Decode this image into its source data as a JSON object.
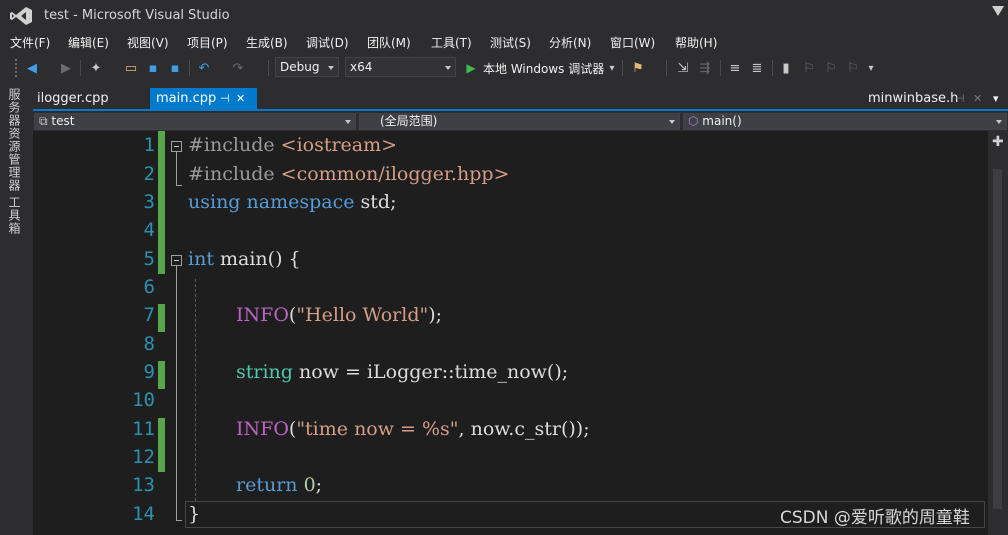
{
  "window": {
    "title": "test - Microsoft Visual Studio",
    "logo_icon": "visual-studio-logo"
  },
  "menu": [
    {
      "label": "文件(F)"
    },
    {
      "label": "编辑(E)"
    },
    {
      "label": "视图(V)"
    },
    {
      "label": "项目(P)"
    },
    {
      "label": "生成(B)"
    },
    {
      "label": "调试(D)"
    },
    {
      "label": "团队(M)"
    },
    {
      "label": "工具(T)"
    },
    {
      "label": "测试(S)"
    },
    {
      "label": "分析(N)"
    },
    {
      "label": "窗口(W)"
    },
    {
      "label": "帮助(H)"
    }
  ],
  "toolbar": {
    "configuration": "Debug",
    "platform": "x64",
    "run_label": "本地 Windows 调试器",
    "run_dropdown_glyph": "▾",
    "icons": {
      "back": "◀",
      "forward": "▶",
      "new_project": "✦",
      "open": "▭",
      "save": "▪",
      "save_all": "▪",
      "undo": "↶",
      "redo": "↷",
      "play": "▶",
      "find": "⚑",
      "comment": "≡",
      "uncomment": "≣",
      "bookmark": "▮"
    }
  },
  "side_rail": {
    "server_explorer": "服务器资源管理器",
    "toolbox": "工具箱"
  },
  "tabs": {
    "items": [
      {
        "label": "ilogger.cpp",
        "active": false
      },
      {
        "label": "main.cpp",
        "active": true,
        "pin": "⊣",
        "close": "✕"
      }
    ],
    "right_tab": "minwinbase.h",
    "right_pin": "⊣",
    "right_close": "✕"
  },
  "navbar": {
    "project": "test",
    "scope": "(全局范围)",
    "member": "main()"
  },
  "editor": {
    "line_numbers": [
      "1",
      "2",
      "3",
      "4",
      "5",
      "6",
      "7",
      "8",
      "9",
      "10",
      "11",
      "12",
      "13",
      "14"
    ],
    "lines": {
      "l1": {
        "directive": "#include",
        "header": "<iostream>"
      },
      "l2": {
        "directive": "#include",
        "header": "<common/ilogger.hpp>"
      },
      "l3": {
        "kw1": "using",
        "kw2": "namespace",
        "rest": "std;"
      },
      "l5": {
        "kw": "int",
        "rest": "main() {"
      },
      "l7": {
        "macro": "INFO",
        "open": "(",
        "str": "\"Hello World\"",
        "close": ");"
      },
      "l9": {
        "type": "string",
        "rest": "now = iLogger::time_now();"
      },
      "l11": {
        "macro": "INFO",
        "open": "(",
        "str": "\"time now = %s\"",
        "rest": ", now.c_str());"
      },
      "l13": {
        "kw": "return",
        "num": "0",
        "end": ";"
      },
      "l14": {
        "brace": "}"
      }
    },
    "change_color": "#57a64a"
  },
  "scrollbar": {
    "split_glyph": "✚"
  },
  "watermark": "CSDN @爱听歌的周童鞋"
}
